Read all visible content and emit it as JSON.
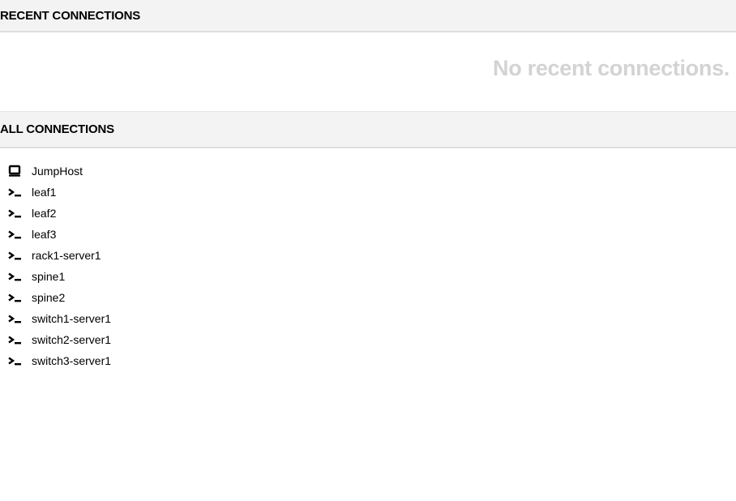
{
  "recent": {
    "header": "RECENT CONNECTIONS",
    "empty_message": "No recent connections."
  },
  "all": {
    "header": "ALL CONNECTIONS",
    "items": [
      {
        "label": "JumpHost",
        "icon": "desktop-icon"
      },
      {
        "label": "leaf1",
        "icon": "terminal-icon"
      },
      {
        "label": "leaf2",
        "icon": "terminal-icon"
      },
      {
        "label": "leaf3",
        "icon": "terminal-icon"
      },
      {
        "label": "rack1-server1",
        "icon": "terminal-icon"
      },
      {
        "label": "spine1",
        "icon": "terminal-icon"
      },
      {
        "label": "spine2",
        "icon": "terminal-icon"
      },
      {
        "label": "switch1-server1",
        "icon": "terminal-icon"
      },
      {
        "label": "switch2-server1",
        "icon": "terminal-icon"
      },
      {
        "label": "switch3-server1",
        "icon": "terminal-icon"
      }
    ]
  }
}
